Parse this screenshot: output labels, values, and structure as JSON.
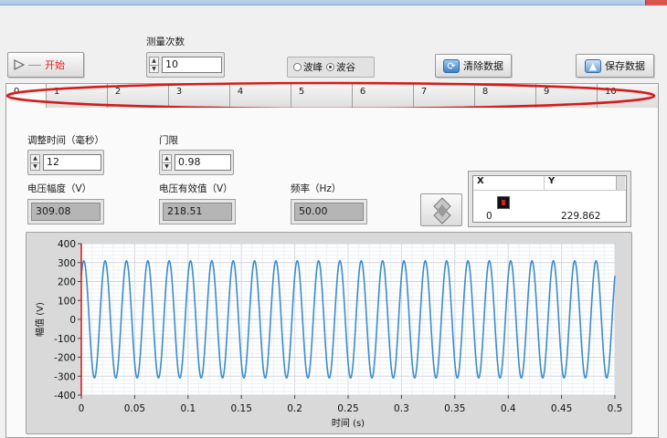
{
  "toolbar": {
    "start_label": "开始",
    "measure_count_label": "测量次数",
    "measure_count_value": "10",
    "radio_peak": "波峰",
    "radio_trough": "波谷",
    "clear_label": "清除数据",
    "save_label": "保存数据"
  },
  "tabs": [
    "0",
    "1",
    "2",
    "3",
    "4",
    "5",
    "6",
    "7",
    "8",
    "9",
    "10"
  ],
  "controls": {
    "adjust_time_label": "调整时间（毫秒）",
    "adjust_time_value": "12",
    "threshold_label": "门限",
    "threshold_value": "0.98"
  },
  "indicators": {
    "amplitude_label": "电压幅度（V）",
    "amplitude_value": "309.08",
    "rms_label": "电压有效值（V）",
    "rms_value": "218.51",
    "freq_label": "频率（Hz）",
    "freq_value": "50.00"
  },
  "xy_table": {
    "headers": [
      "X",
      "Y"
    ],
    "rows": [
      [
        "0",
        "229.862"
      ]
    ]
  },
  "accent": "#3d8cc8",
  "chart_data": {
    "type": "line",
    "xlabel": "时间 (s)",
    "ylabel": "幅值 (V)",
    "xlim": [
      0,
      0.5
    ],
    "ylim": [
      -400,
      400
    ],
    "xticks": [
      "0",
      "0.05",
      "0.1",
      "0.15",
      "0.2",
      "0.25",
      "0.3",
      "0.35",
      "0.4",
      "0.45",
      "0.5"
    ],
    "yticks": [
      "400",
      "300",
      "200",
      "100",
      "0",
      "-100",
      "-200",
      "-300",
      "-400"
    ],
    "series": [
      {
        "function": "y = 309.08 * sin(2*pi*50*t + phase)",
        "amplitude": 309.08,
        "frequency_hz": 50,
        "y_at_t0": 229.862,
        "t_range": [
          0,
          0.5
        ],
        "color": "#3d8cc8"
      }
    ],
    "cursor_x": 0,
    "cursor_color": "#d42020",
    "grid": true
  },
  "annotation": {
    "color": "#d61b1b"
  }
}
